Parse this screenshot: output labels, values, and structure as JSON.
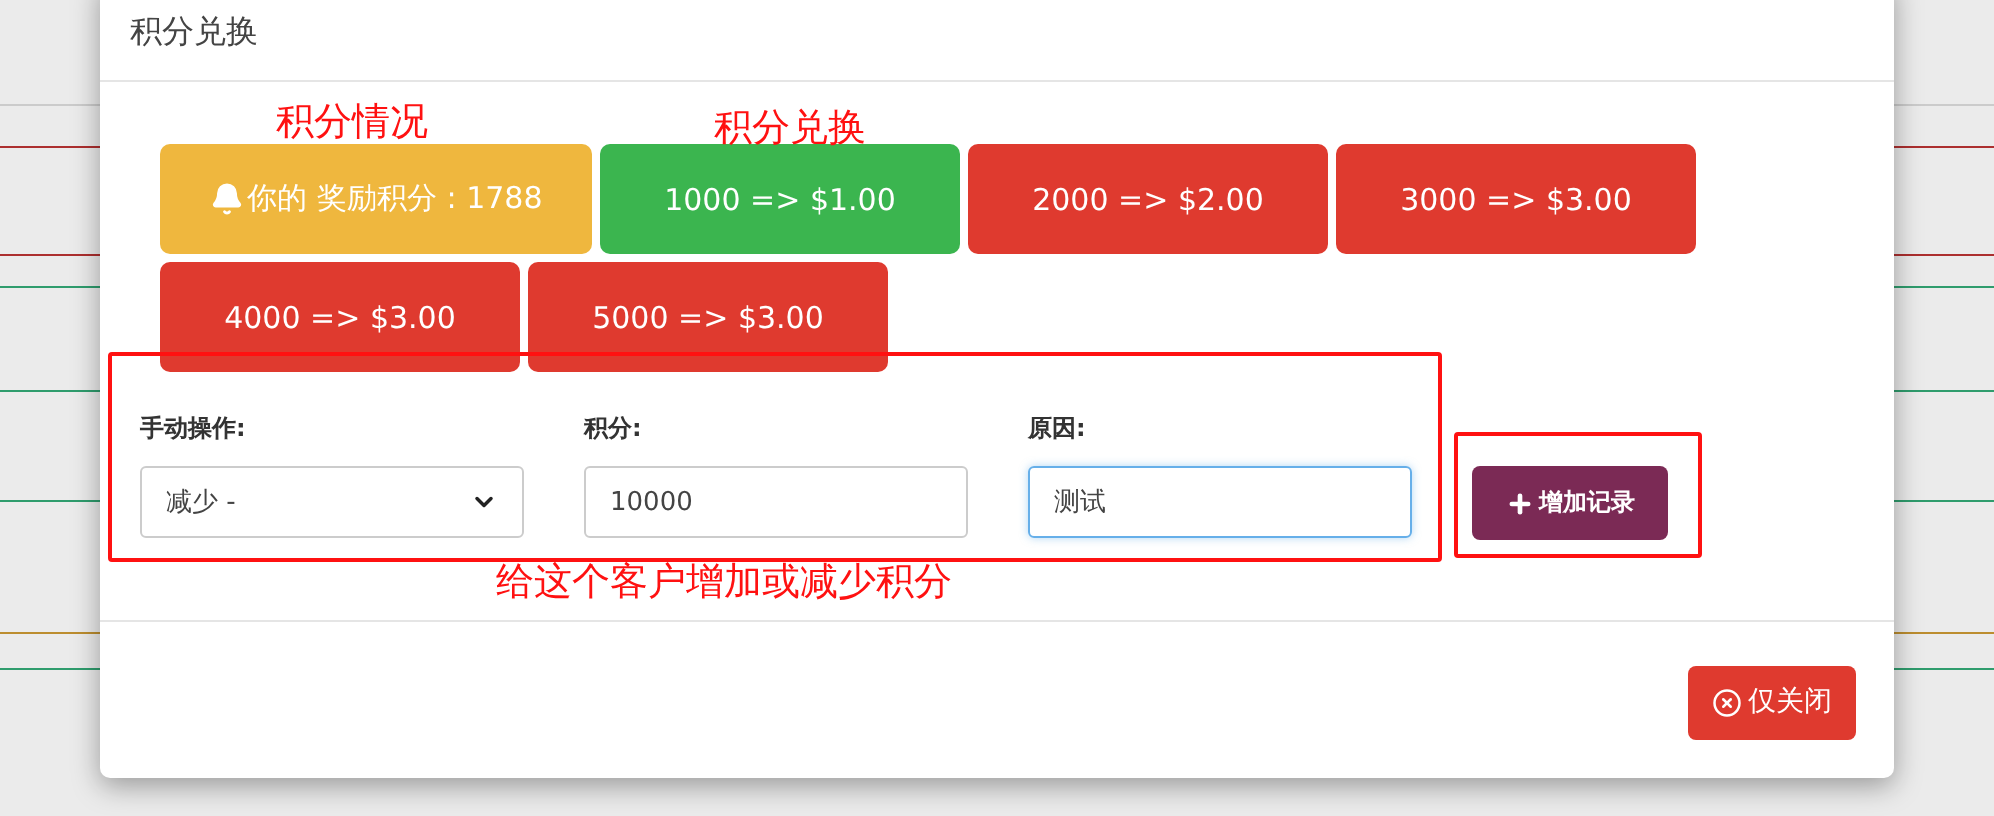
{
  "dialog": {
    "title": "积分兑换",
    "balance": {
      "label": "你的 奖励积分 : 1788"
    },
    "exchange_buttons": [
      {
        "label": "1000 => $1.00",
        "color": "#3bb54f"
      },
      {
        "label": "2000 => $2.00",
        "color": "#df3a2f"
      },
      {
        "label": "3000 => $3.00",
        "color": "#df3a2f"
      },
      {
        "label": "4000 => $3.00",
        "color": "#df3a2f"
      },
      {
        "label": "5000 => $3.00",
        "color": "#df3a2f"
      }
    ],
    "form": [
      {
        "kind": "select",
        "label": "手动操作:",
        "value": "减少 -",
        "focused": false
      },
      {
        "kind": "input",
        "label": "积分:",
        "value": "10000",
        "focused": false
      },
      {
        "kind": "input",
        "label": "原因:",
        "value": "测试",
        "focused": true
      }
    ],
    "add_button": "增加记录",
    "close_button": "仅关闭"
  },
  "annotations": [
    "积分情况",
    "积分兑换",
    "给这个客户增加或减少积分"
  ]
}
